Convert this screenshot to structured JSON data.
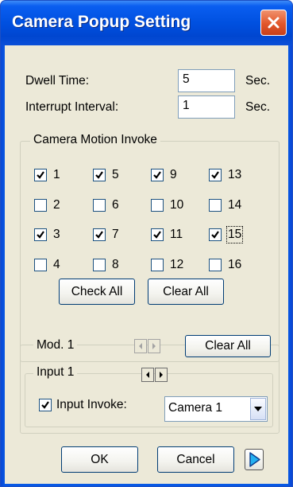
{
  "window": {
    "title": "Camera Popup Setting"
  },
  "dwell": {
    "label": "Dwell Time:",
    "value": "5",
    "unit": "Sec."
  },
  "interrupt": {
    "label": "Interrupt Interval:",
    "value": "1",
    "unit": "Sec."
  },
  "motion": {
    "title": "Camera Motion Invoke",
    "cameras": [
      {
        "label": "1",
        "checked": true
      },
      {
        "label": "5",
        "checked": true
      },
      {
        "label": "9",
        "checked": true
      },
      {
        "label": "13",
        "checked": true
      },
      {
        "label": "2",
        "checked": false
      },
      {
        "label": "6",
        "checked": false
      },
      {
        "label": "10",
        "checked": false
      },
      {
        "label": "14",
        "checked": false
      },
      {
        "label": "3",
        "checked": true
      },
      {
        "label": "7",
        "checked": true
      },
      {
        "label": "11",
        "checked": true
      },
      {
        "label": "15",
        "checked": true
      },
      {
        "label": "4",
        "checked": false
      },
      {
        "label": "8",
        "checked": false
      },
      {
        "label": "12",
        "checked": false
      },
      {
        "label": "16",
        "checked": false
      }
    ],
    "check_all": "Check All",
    "clear_all": "Clear All"
  },
  "mod": {
    "title": "Mod. 1",
    "clear_all": "Clear All",
    "input": {
      "title": "Input 1",
      "invoke_label": "Input Invoke:",
      "invoke_checked": true,
      "camera_select": "Camera 1"
    }
  },
  "footer": {
    "ok": "OK",
    "cancel": "Cancel"
  }
}
